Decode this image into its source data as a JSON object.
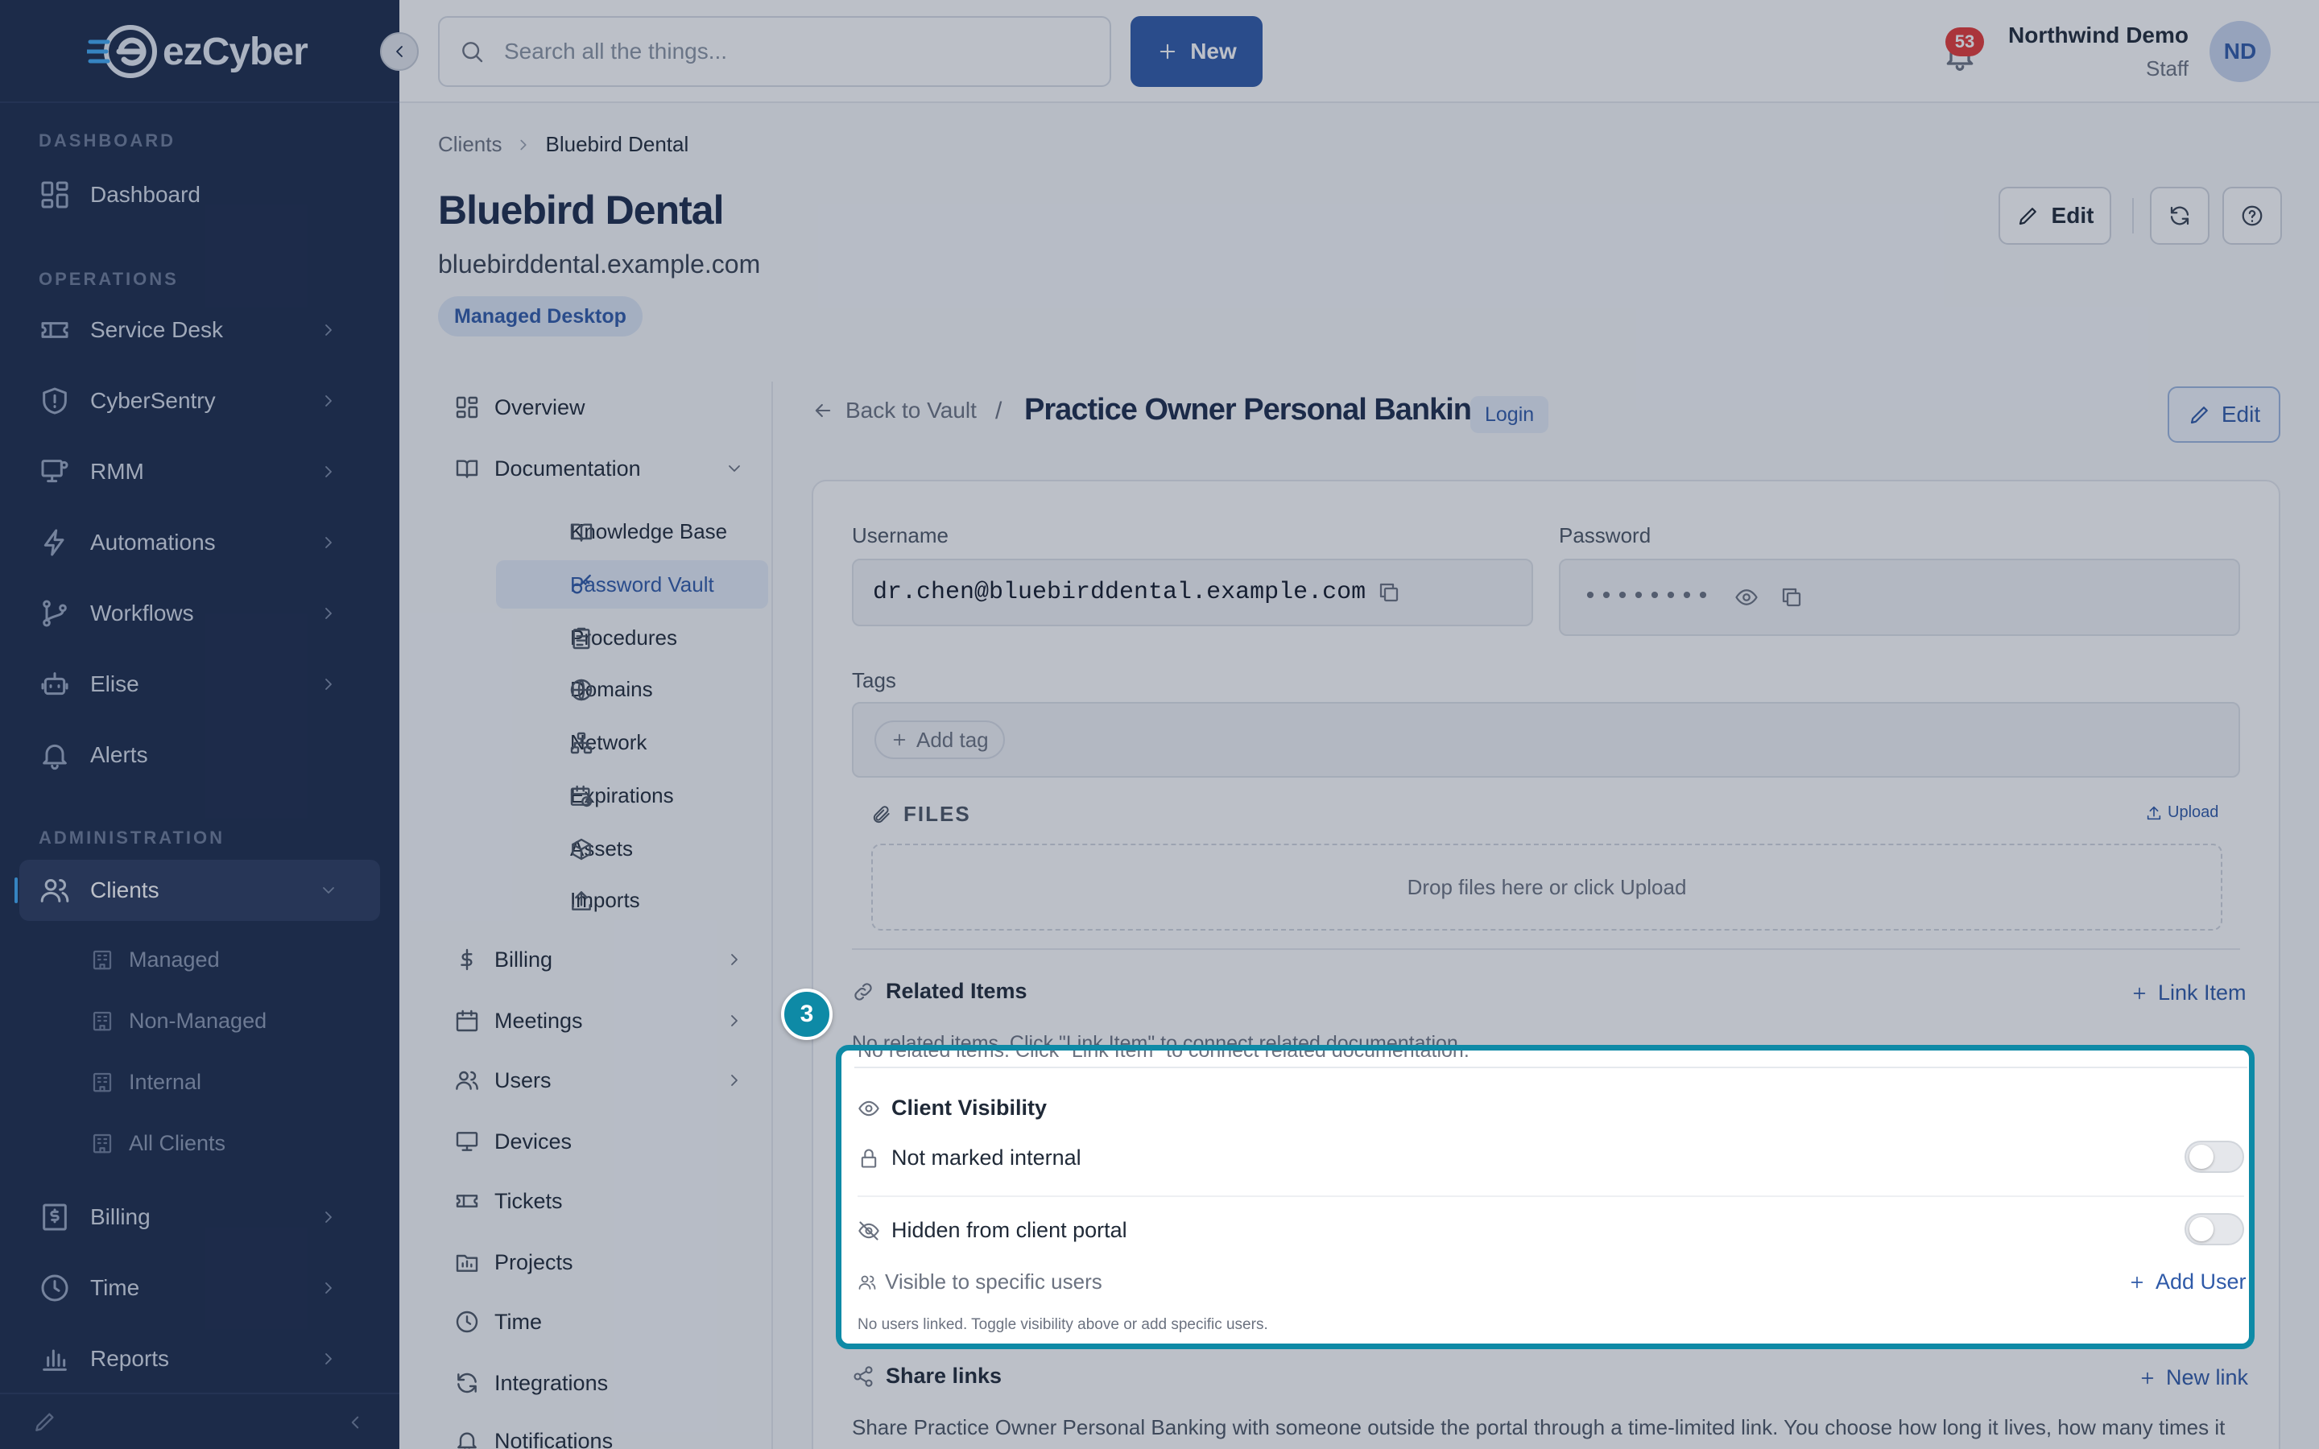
{
  "app": {
    "logo_text": "ezCyber"
  },
  "sidebar": {
    "sections": {
      "dashboard": "DASHBOARD",
      "operations": "OPERATIONS",
      "administration": "ADMINISTRATION"
    },
    "items": {
      "dashboard": "Dashboard",
      "service_desk": "Service Desk",
      "cybersentry": "CyberSentry",
      "rmm": "RMM",
      "automations": "Automations",
      "workflows": "Workflows",
      "elise": "Elise",
      "alerts": "Alerts",
      "clients": "Clients",
      "billing": "Billing",
      "time": "Time",
      "reports": "Reports"
    },
    "client_sub": [
      "Managed",
      "Non-Managed",
      "Internal",
      "All Clients"
    ]
  },
  "header": {
    "search_placeholder": "Search all the things...",
    "new_label": "New",
    "notification_count": "53",
    "user_name": "Northwind Demo",
    "user_role": "Staff",
    "avatar_initials": "ND"
  },
  "breadcrumb": {
    "parent": "Clients",
    "current": "Bluebird Dental"
  },
  "client": {
    "name": "Bluebird Dental",
    "domain": "bluebirddental.example.com",
    "tag": "Managed Desktop",
    "edit_label": "Edit"
  },
  "subnav": {
    "overview": "Overview",
    "documentation": "Documentation",
    "doc_items": [
      "Knowledge Base",
      "Password Vault",
      "Procedures",
      "Domains",
      "Network",
      "Expirations",
      "Assets",
      "Imports"
    ],
    "billing": "Billing",
    "meetings": "Meetings",
    "users": "Users",
    "devices": "Devices",
    "tickets": "Tickets",
    "projects": "Projects",
    "time": "Time",
    "integrations": "Integrations",
    "notifications": "Notifications"
  },
  "vault_item": {
    "back_label": "Back to Vault",
    "slash": "/",
    "title": "Practice Owner Personal Banking",
    "type": "Login",
    "edit_label": "Edit",
    "username_label": "Username",
    "username": "dr.chen@bluebirddental.example.com",
    "password_label": "Password",
    "password_mask": "••••••••",
    "tags_label": "Tags",
    "add_tag_label": "Add tag",
    "files_label": "FILES",
    "upload_label": "Upload",
    "dropzone_text": "Drop files here or click Upload",
    "related_title": "Related Items",
    "link_item_label": "Link Item",
    "related_empty": "No related items. Click \"Link Item\" to connect related documentation.",
    "visibility_title": "Client Visibility",
    "not_internal_label": "Not marked internal",
    "not_internal_on": false,
    "hidden_portal_label": "Hidden from client portal",
    "hidden_portal_on": false,
    "specific_users_label": "Visible to specific users",
    "add_user_label": "Add User",
    "no_users_text": "No users linked. Toggle visibility above or add specific users.",
    "share_title": "Share links",
    "new_link_label": "New link",
    "share_desc": "Share Practice Owner Personal Banking with someone outside the portal through a time-limited link. You choose how long it lives, how many times it"
  },
  "tour": {
    "step_number": "3",
    "highlight_color": "#0e8aa6"
  },
  "colors": {
    "sidebar_bg": "#1b2a4a",
    "primary": "#2f5aa8",
    "badge": "#e53935"
  }
}
